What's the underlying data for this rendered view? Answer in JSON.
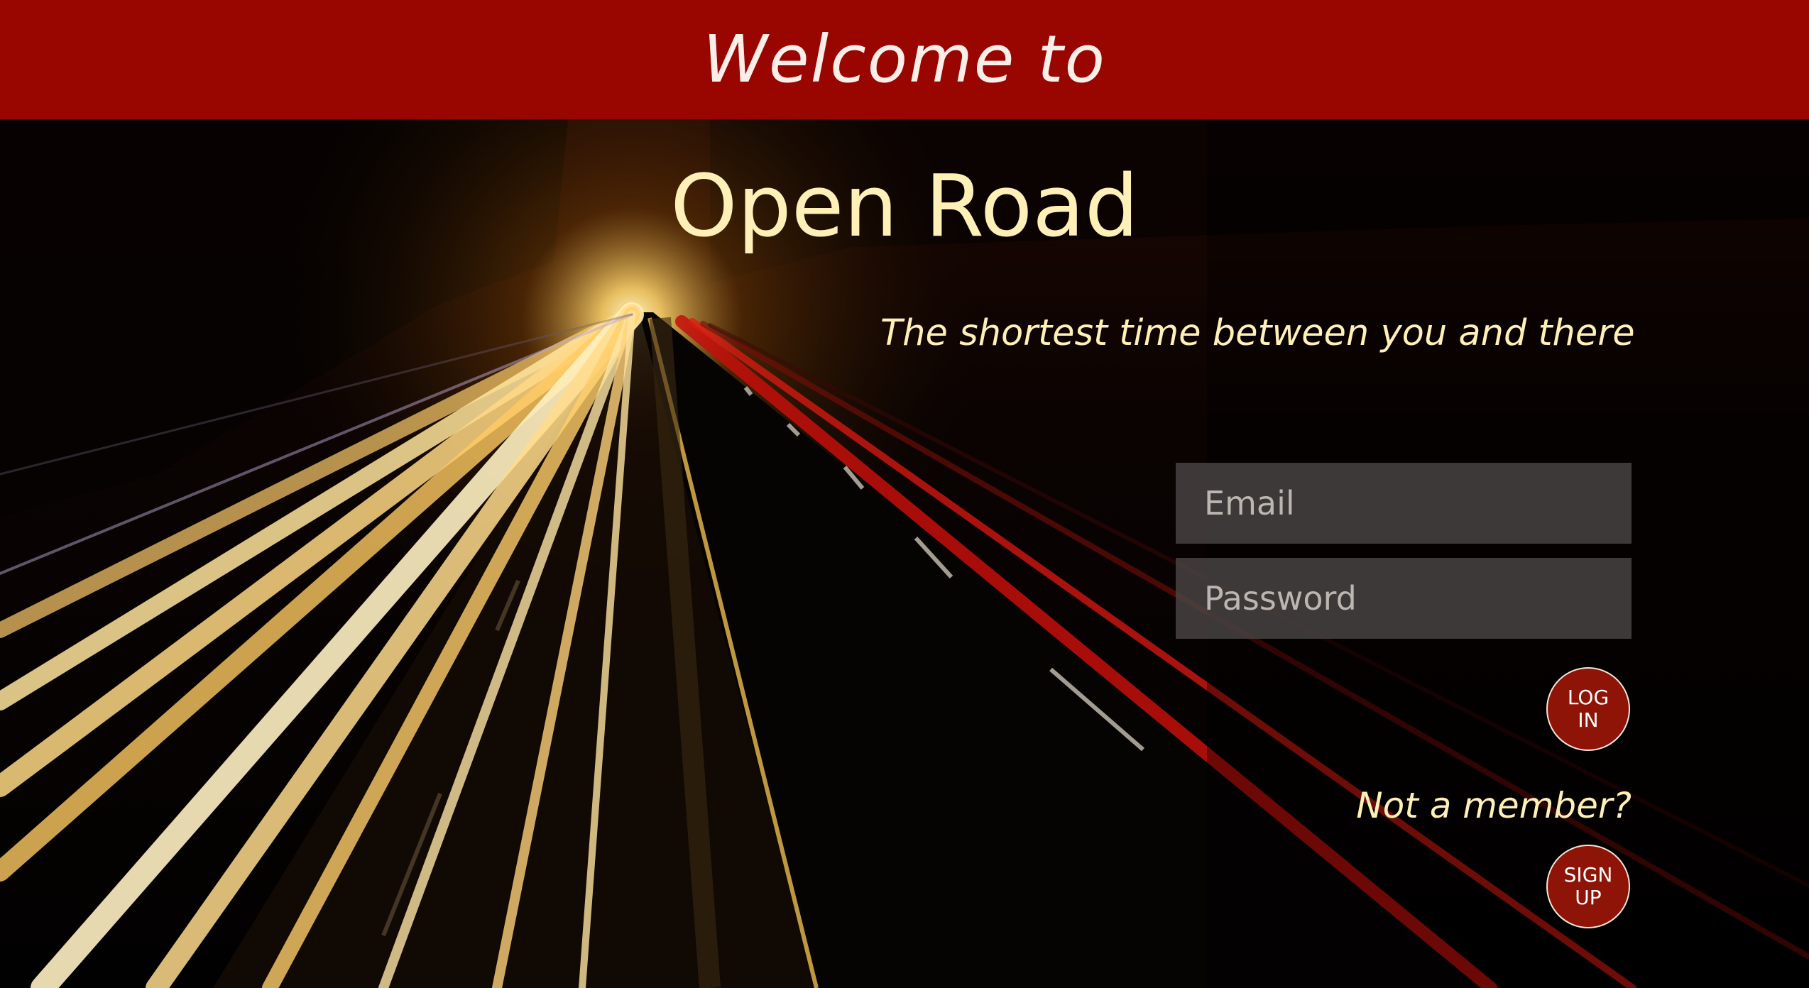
{
  "header": {
    "welcome_text": "Welcome to"
  },
  "hero": {
    "title": "Open Road",
    "tagline": "The shortest time between you and there"
  },
  "login_form": {
    "email_placeholder": "Email",
    "password_placeholder": "Password",
    "login_label": "LOG IN",
    "not_member_text": "Not a member?",
    "signup_label": "SIGN UP"
  },
  "colors": {
    "header_bg": "#990600",
    "accent_text": "#fff0b8",
    "button_bg": "#8d1406",
    "field_bg": "#4a4644"
  }
}
